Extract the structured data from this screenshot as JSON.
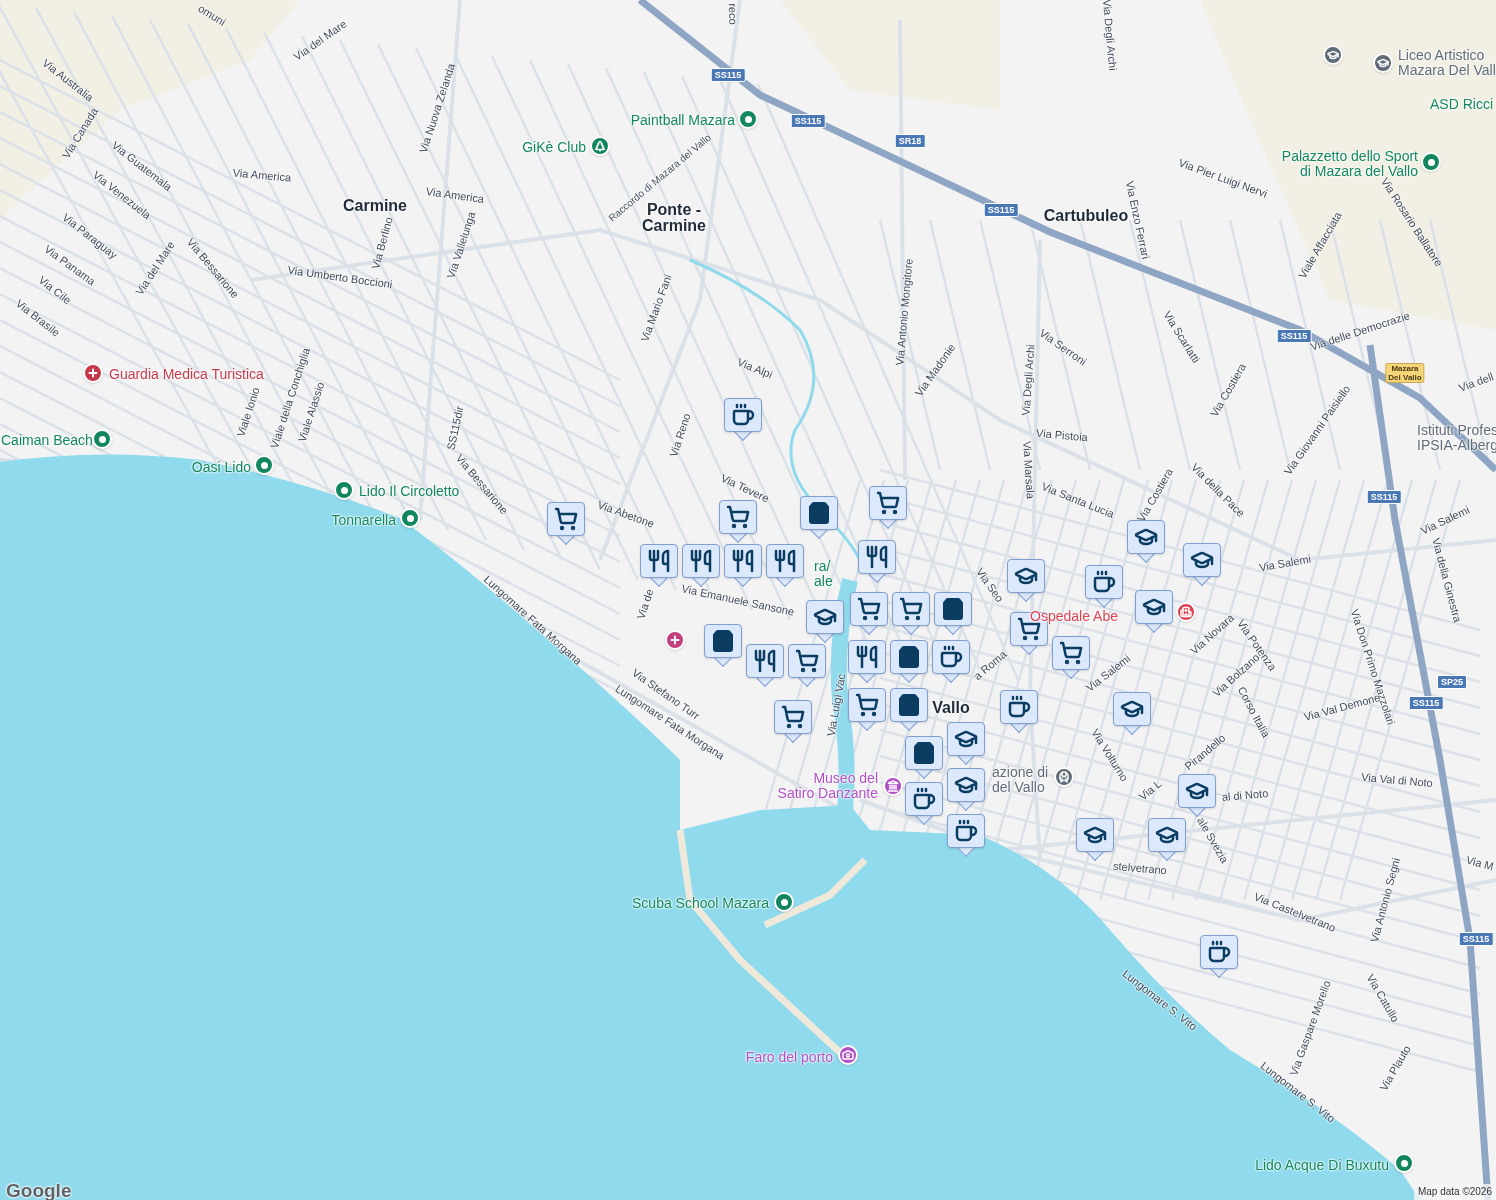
{
  "map": {
    "districts": [
      {
        "lines": [
          "Carmine"
        ]
      },
      {
        "lines": [
          "Ponte -",
          "Carmine"
        ]
      },
      {
        "lines": [
          "Cartubuleo"
        ]
      },
      {
        "lines": [
          "Vallo"
        ]
      }
    ],
    "streets": [
      "omuni",
      "Via del Mare",
      "reco",
      "Via Australia",
      "Via Canada",
      "Via Guatemala",
      "Via Venezuela",
      "Via Nuova Zelanda",
      "Via America",
      "Via America",
      "Via Paraguay",
      "Via del Mare",
      "Via Bessarione",
      "Via Panama",
      "Via Cile",
      "Via Brasile",
      "Via Berlino",
      "Via Vallelunga",
      "Via Umberto Boccioni",
      "Raccordo di Mazara del Vallo",
      "Via Mario Fani",
      "Viale Ionio",
      "Viale della Conchiglia",
      "Viale Alassio",
      "SS115dir",
      "Via Bessarione",
      "Via Reno",
      "Via Alpi",
      "Via Tevere",
      "Via Abetone",
      "Via de",
      "Via Emanuele Sansone",
      "Via Luigi Vac",
      "Lungomare Fata Morgana",
      "Via Stefano Turr",
      "Lungomare Fata Morgana",
      "Via Degli Archi",
      "Via Pier Luigi Nervi",
      "Via Enzo Ferrari",
      "Via Antonio Mongitore",
      "Via Madonie",
      "Via Serroni",
      "Via Degli Archi",
      "Via Scarlatti",
      "Viale Affacciata",
      "Via Rosario Ballatore",
      "Via delle Democrazie",
      "Via Costiera",
      "Via Pistoia",
      "Via Marsala",
      "Via Santa Lucia",
      "Via Costiera",
      "Via della Pace",
      "Via Giovanni Paisiello",
      "Via dell",
      "Via Salemi",
      "Via della Ginestra",
      "Via Seo",
      "a Roma",
      "Via Salemi",
      "Via Novara",
      "Via Potenza",
      "Via Bolzano",
      "Corso Italia",
      "Via Salemi",
      "Via Don Primo Mazzolari",
      "Via Val Demone",
      "Via Volturno",
      "Pirandello",
      "Via L",
      "al di Noto",
      "Via Val di Noto",
      "stelvetrano",
      "ale Svezia",
      "Via Castelvetrano",
      "Via Antonio Segni",
      "Via M",
      "Lungomare S. Vito",
      "Via Gaspare Morello",
      "Via Catullo",
      "Lungomare S. Vito",
      "Via Plauto"
    ],
    "road_shields": [
      {
        "kind": "road",
        "lines": [
          "SS115"
        ]
      },
      {
        "kind": "road",
        "lines": [
          "SS115"
        ]
      },
      {
        "kind": "road",
        "lines": [
          "SR18"
        ]
      },
      {
        "kind": "road",
        "lines": [
          "SS115"
        ]
      },
      {
        "kind": "road",
        "lines": [
          "SS115"
        ]
      },
      {
        "kind": "road",
        "lines": [
          "SS115"
        ]
      },
      {
        "kind": "road",
        "lines": [
          "SP25"
        ]
      },
      {
        "kind": "road",
        "lines": [
          "SS115"
        ]
      },
      {
        "kind": "road",
        "lines": [
          "SS115"
        ]
      },
      {
        "kind": "exit",
        "lines": [
          "Mazara",
          "Del Vallo"
        ]
      }
    ],
    "places": [
      {
        "lines": [
          "Paintball Mazara"
        ],
        "kind": "park",
        "color": "#12875f"
      },
      {
        "lines": [
          "GiKè Club"
        ],
        "kind": "tree",
        "color": "#12875f"
      },
      {
        "lines": [
          "Guardia Medica Turistica"
        ],
        "kind": "hospital",
        "color": "#c5394a"
      },
      {
        "lines": [
          "Caiman Beach"
        ],
        "kind": "park",
        "color": "#12875f"
      },
      {
        "lines": [
          "Oasi Lido"
        ],
        "kind": "park",
        "color": "#12875f"
      },
      {
        "lines": [
          "Lido Il Circoletto"
        ],
        "kind": "park",
        "color": "#12875f"
      },
      {
        "lines": [
          "Tonnarella"
        ],
        "kind": "park",
        "color": "#12875f"
      },
      {
        "lines": [
          "Liceo Artistico",
          "Mazara Del Vall"
        ],
        "kind": "school",
        "color": "#5f6b77"
      },
      {
        "lines": [
          "ASD Ricci"
        ],
        "kind": "park",
        "color": "#12875f"
      },
      {
        "lines": [
          "Palazzetto dello Sport",
          "di Mazara del Vallo"
        ],
        "kind": "park",
        "color": "#12875f"
      },
      {
        "lines": [
          "Istituti Profes",
          "IPSIA-Alberg"
        ],
        "kind": "school",
        "color": "#5f6b77"
      },
      {
        "lines": [
          "Ospedale Abe"
        ],
        "kind": "hospital_h",
        "color": "#e0414f"
      },
      {
        "lines": [
          "ra/",
          "ale"
        ],
        "kind": "park",
        "color": "#12875f"
      },
      {
        "lines": [
          "Museo del",
          "Satiro Danzante"
        ],
        "kind": "museum",
        "color": "#b14fc5"
      },
      {
        "lines": [
          "azione di",
          "del Vallo"
        ],
        "kind": "station",
        "color": "#5f6b77"
      },
      {
        "lines": [
          "Scuba School Mazara"
        ],
        "kind": "park",
        "color": "#12875f"
      },
      {
        "lines": [
          "Faro del porto"
        ],
        "kind": "camera",
        "color": "#b14fc5"
      },
      {
        "lines": [
          "Lido Acque Di Buxutu"
        ],
        "kind": "park",
        "color": "#12875f"
      },
      {
        "kind": "hospital",
        "color": "#c2407e"
      },
      {
        "kind": "school",
        "color": "#5f6b77"
      }
    ],
    "markers": [
      {
        "kind": "cup"
      },
      {
        "kind": "cart"
      },
      {
        "kind": "cart"
      },
      {
        "kind": "cart"
      },
      {
        "kind": "fork"
      },
      {
        "kind": "fork"
      },
      {
        "kind": "fork"
      },
      {
        "kind": "fork"
      },
      {
        "kind": "bag"
      },
      {
        "kind": "fork"
      },
      {
        "kind": "cart"
      },
      {
        "kind": "cart"
      },
      {
        "kind": "school"
      },
      {
        "kind": "fork"
      },
      {
        "kind": "bag"
      },
      {
        "kind": "school"
      },
      {
        "kind": "cart"
      },
      {
        "kind": "cart"
      },
      {
        "kind": "cup"
      },
      {
        "kind": "bag"
      },
      {
        "kind": "cart"
      },
      {
        "kind": "cart"
      },
      {
        "kind": "fork"
      },
      {
        "kind": "bag"
      },
      {
        "kind": "cart"
      },
      {
        "kind": "bag"
      },
      {
        "kind": "bag"
      },
      {
        "kind": "school"
      },
      {
        "kind": "cup"
      },
      {
        "kind": "school"
      },
      {
        "kind": "cup"
      },
      {
        "kind": "cup"
      },
      {
        "kind": "school"
      },
      {
        "kind": "cup"
      },
      {
        "kind": "school"
      },
      {
        "kind": "school"
      },
      {
        "kind": "school"
      },
      {
        "kind": "school"
      },
      {
        "kind": "school"
      },
      {
        "kind": "school"
      },
      {
        "kind": "cup"
      }
    ],
    "attribution": {
      "logo": "Google",
      "text": "Map data ©2026"
    }
  }
}
